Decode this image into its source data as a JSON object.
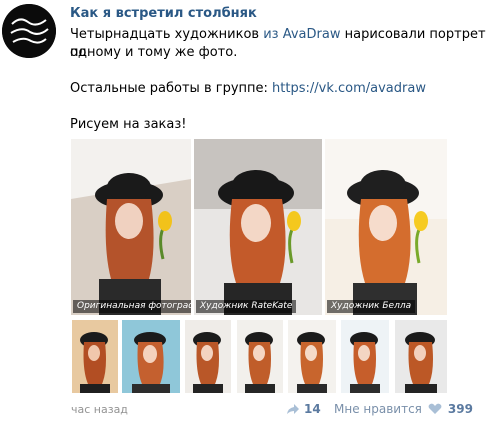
{
  "post": {
    "title": "Как я встретил столбняк",
    "line1_a": "Четырнадцать художников",
    "line1_link": "из AvaDraw",
    "line1_b": "нарисовали портрет по",
    "line2": "одному и тому же фото.",
    "line3_a": "Остальные работы в группе:",
    "line3_link": "https://vk.com/avadraw",
    "line4": "Рисуем на заказ!"
  },
  "avatar_text": "Как я встретил столбняк",
  "images": {
    "big": [
      {
        "caption": "Оригинальная фотография"
      },
      {
        "caption": "Художник RateKate"
      },
      {
        "caption": "Художник Белла"
      }
    ]
  },
  "footer": {
    "time": "час назад",
    "shares": "14",
    "likes_label": "Мне нравится",
    "likes_count": "399"
  },
  "colors": {
    "link": "#2a5885",
    "muted": "#939393",
    "accent": "#5b7aa0"
  }
}
